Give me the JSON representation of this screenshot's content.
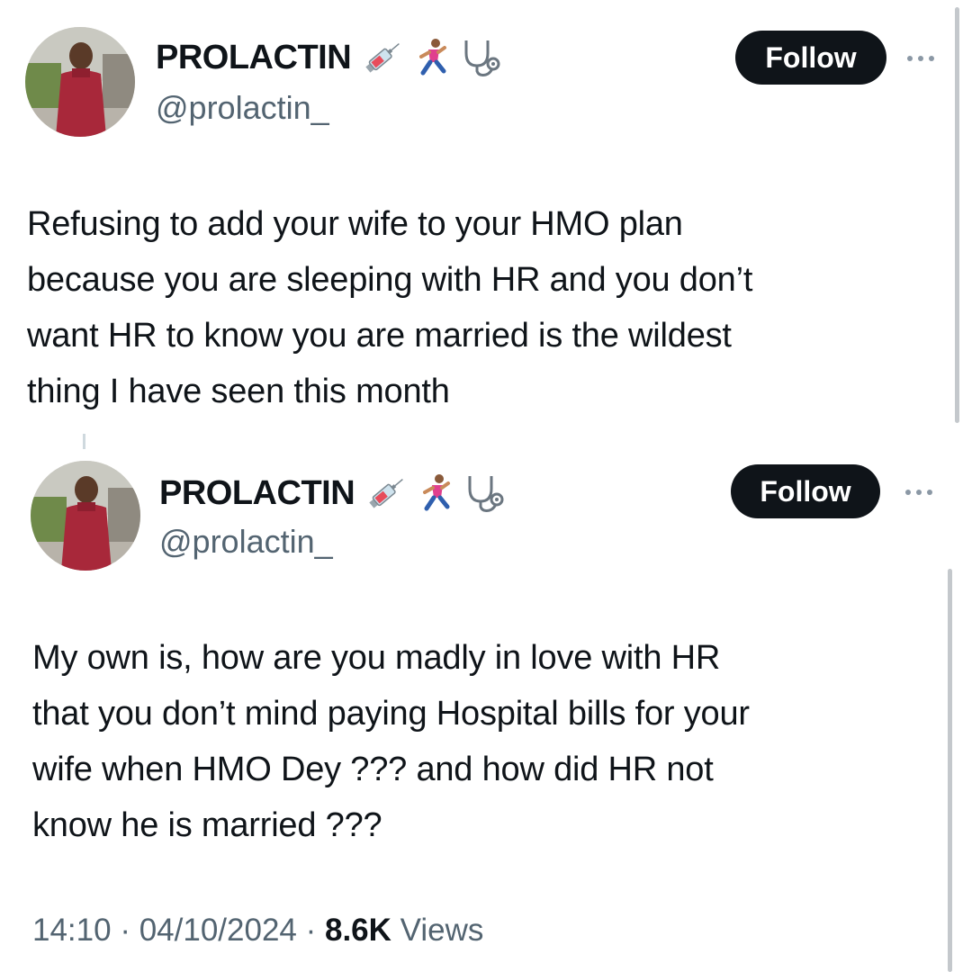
{
  "tweets": [
    {
      "author": {
        "display_name": "PROLACTIN",
        "handle": "@prolactin_",
        "name_emojis": [
          "syringe-emoji",
          "runner-emoji",
          "stethoscope-emoji"
        ]
      },
      "follow_label": "Follow",
      "text": "Refusing to add your wife to your HMO plan\nbecause you are sleeping with HR and you don’t\nwant HR to know you are married is the wildest\nthing I have seen this month"
    },
    {
      "author": {
        "display_name": "PROLACTIN",
        "handle": "@prolactin_",
        "name_emojis": [
          "syringe-emoji",
          "runner-emoji",
          "stethoscope-emoji"
        ]
      },
      "follow_label": "Follow",
      "text": "My own is, how are you madly in love with HR\nthat you don’t mind paying Hospital bills for your\nwife when HMO Dey ??? and how did HR not\nknow he is married ???",
      "meta": {
        "time": "14:10",
        "separator": " · ",
        "date": "04/10/2024",
        "views_count": "8.6K",
        "views_label": "Views"
      }
    }
  ],
  "colors": {
    "text_primary": "#0f1419",
    "text_secondary": "#536471",
    "follow_bg": "#0f1419",
    "follow_text": "#ffffff"
  }
}
